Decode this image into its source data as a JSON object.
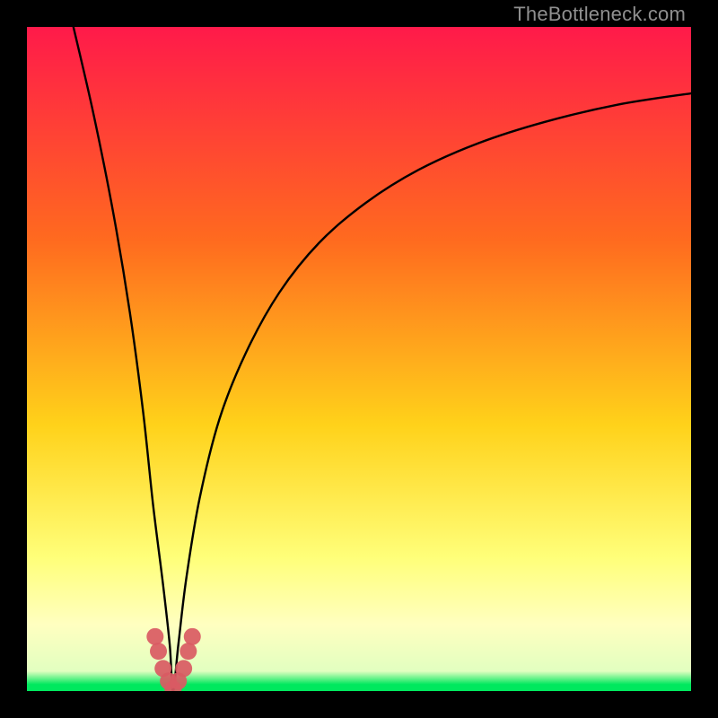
{
  "watermark": "TheBottleneck.com",
  "colors": {
    "gradient_top": "#ff1a4a",
    "gradient_mid1": "#ff6a1f",
    "gradient_mid2": "#ffd21a",
    "gradient_mid3": "#ffff7a",
    "gradient_band": "#ffffc0",
    "gradient_green": "#00e85e",
    "curve_stroke": "#000000",
    "marker_fill": "#d95a63",
    "marker_stroke": "#d95a63",
    "black": "#000000",
    "watermark": "#8f8f8f"
  },
  "chart_data": {
    "type": "line",
    "title": "",
    "xlabel": "",
    "ylabel": "",
    "xlim": [
      0,
      100
    ],
    "ylim": [
      0,
      100
    ],
    "notch_x": 22,
    "series": [
      {
        "name": "bottleneck_curve",
        "x": [
          7,
          10,
          13,
          15.5,
          17.5,
          19,
          20.5,
          21.5,
          22,
          22.8,
          24,
          26,
          29,
          33,
          38,
          44,
          51,
          59,
          68,
          78,
          89,
          100
        ],
        "values": [
          100,
          87,
          72,
          57,
          42,
          28,
          16,
          7,
          0,
          7,
          17,
          29,
          41,
          51,
          60,
          67.5,
          73.5,
          78.5,
          82.5,
          85.7,
          88.3,
          90
        ]
      }
    ],
    "markers": {
      "name": "highlight_points",
      "x": [
        19.3,
        19.8,
        20.5,
        21.3,
        22.0,
        22.8,
        23.6,
        24.3,
        24.9
      ],
      "values": [
        8.2,
        6.0,
        3.4,
        1.5,
        0.3,
        1.5,
        3.4,
        6.0,
        8.2
      ]
    }
  }
}
